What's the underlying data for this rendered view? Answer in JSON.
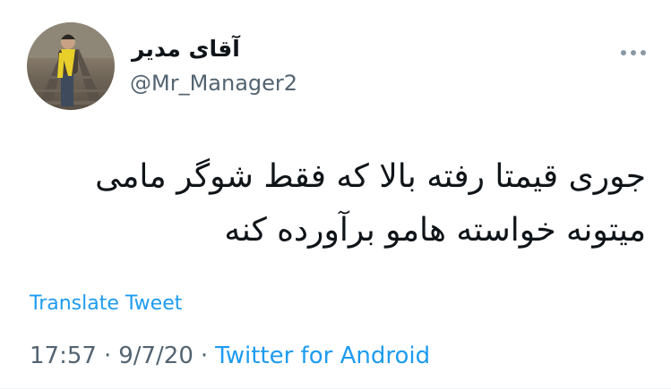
{
  "author": {
    "display_name": "آقای مدیر",
    "username": "@Mr_Manager2"
  },
  "tweet": {
    "lines": [
      "جوری قیمتا رفته بالا که فقط شوگر مامی",
      "میتونه خواسته هامو برآورده کنه"
    ]
  },
  "translate_label": "Translate Tweet",
  "meta": {
    "time": "17:57",
    "separator": "·",
    "date": "9/7/20",
    "source": "Twitter for Android"
  },
  "colors": {
    "link": "#1d9bf0",
    "secondary_text": "#536471",
    "primary_text": "#0f1419"
  },
  "icons": {
    "more": "more-horizontal-icon"
  }
}
